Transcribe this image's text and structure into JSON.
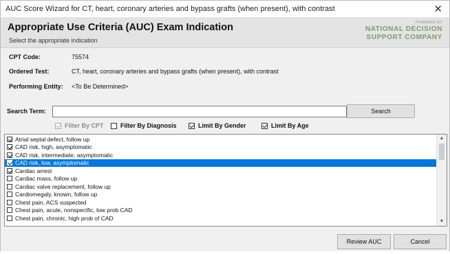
{
  "window": {
    "title": "AUC Score Wizard for CT, heart, coronary arteries and bypass grafts (when present), with contrast",
    "close_glyph": "✕"
  },
  "header": {
    "title": "Appropriate Use Criteria (AUC) Exam Indication",
    "subtitle": "Select the appropriate indication",
    "logo_powered": "POWERED BY",
    "logo_line1": "NATIONAL DECISION",
    "logo_line2": "SUPPORT COMPANY"
  },
  "info": {
    "cpt_label": "CPT Code:",
    "cpt_value": "75574",
    "test_label": "Ordered Test:",
    "test_value": "CT, heart, coronary arteries and bypass grafts (when present), with contrast",
    "entity_label": "Performing Entity:",
    "entity_value": "<To Be Determined>"
  },
  "search": {
    "label": "Search Term:",
    "value": "",
    "button": "Search"
  },
  "filters": [
    {
      "label": "Filter By CPT",
      "checked": true,
      "disabled": true
    },
    {
      "label": "Filter By Diagnosis",
      "checked": false,
      "disabled": false
    },
    {
      "label": "Limit By Gender",
      "checked": true,
      "disabled": false
    },
    {
      "label": "Limit By Age",
      "checked": true,
      "disabled": false
    }
  ],
  "indications": [
    {
      "label": "Atrial septal defect, follow up",
      "checked": true,
      "selected": false
    },
    {
      "label": "CAD risk, high, asymptomatic",
      "checked": true,
      "selected": false
    },
    {
      "label": "CAD risk, intermediate, asymptomatic",
      "checked": true,
      "selected": false
    },
    {
      "label": "CAD risk, low, asymptomatic",
      "checked": true,
      "selected": true
    },
    {
      "label": "Cardiac arrest",
      "checked": true,
      "selected": false
    },
    {
      "label": "Cardiac mass, follow up",
      "checked": false,
      "selected": false
    },
    {
      "label": "Cardiac valve replacement, follow up",
      "checked": false,
      "selected": false
    },
    {
      "label": "Cardiomegaly, known, follow up",
      "checked": false,
      "selected": false
    },
    {
      "label": "Chest pain, ACS suspected",
      "checked": false,
      "selected": false
    },
    {
      "label": "Chest pain, acute, nonspecific, low prob CAD",
      "checked": false,
      "selected": false
    },
    {
      "label": "Chest pain, chronic, high prob of CAD",
      "checked": false,
      "selected": false
    }
  ],
  "scrollbar": {
    "up_glyph": "▲",
    "down_glyph": "▼"
  },
  "buttons": {
    "review": "Review AUC",
    "cancel": "Cancel"
  }
}
